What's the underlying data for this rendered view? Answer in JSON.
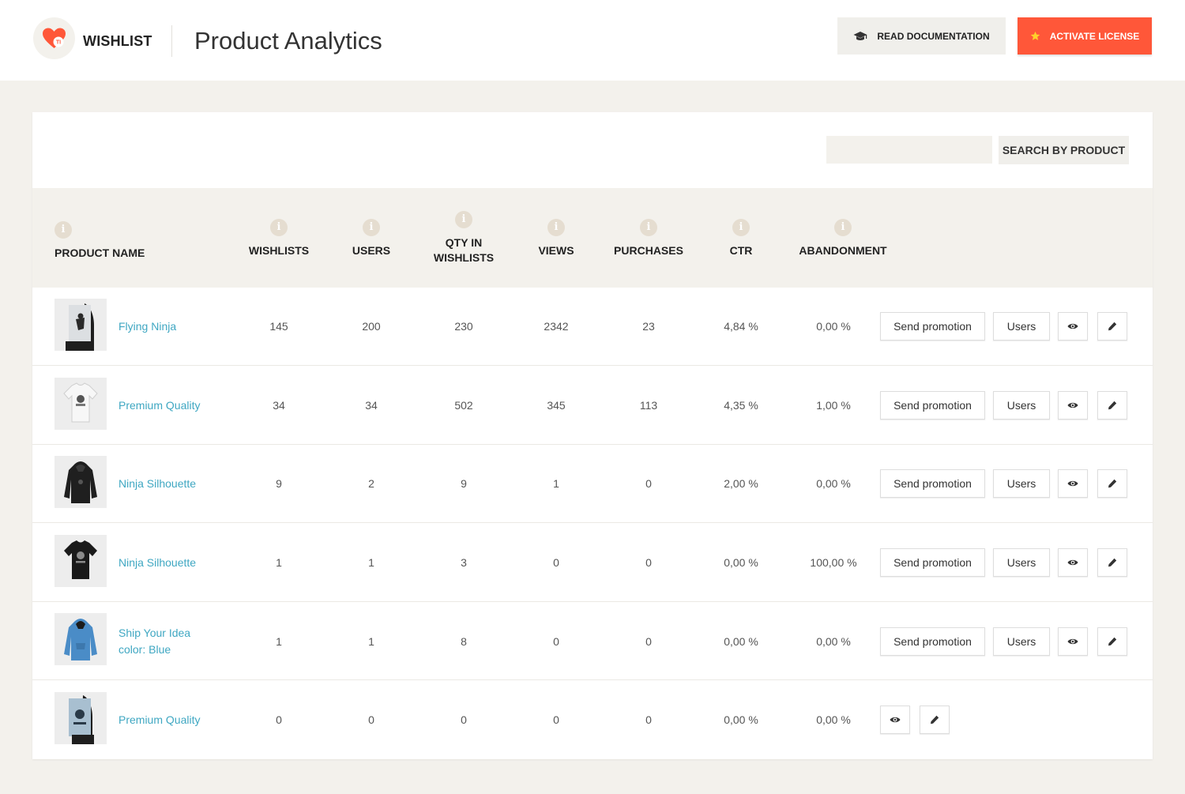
{
  "header": {
    "brand": "WISHLIST",
    "logo_badge": "TI",
    "title": "Product Analytics",
    "doc_button": "READ DOCUMENTATION",
    "license_button": "ACTIVATE LICENSE",
    "colors": {
      "accent": "#ff5739",
      "link": "#3fa7c2",
      "background": "#f3f1ec"
    }
  },
  "search": {
    "value": "",
    "button": "SEARCH BY PRODUCT"
  },
  "table": {
    "info_glyph": "i",
    "columns": {
      "product": "PRODUCT NAME",
      "wishlists": "WISHLISTS",
      "users": "USERS",
      "qty_line1": "QTY IN",
      "qty_line2": "WISHLISTS",
      "views": "VIEWS",
      "purchases": "PURCHASES",
      "ctr": "CTR",
      "abandonment": "ABANDONMENT"
    },
    "action_labels": {
      "promotion": "Send promotion",
      "users": "Users"
    },
    "rows": [
      {
        "name": "Flying Ninja",
        "thumb": "poster-icon",
        "wishlists": "145",
        "users": "200",
        "qty": "230",
        "views": "2342",
        "purchases": "23",
        "ctr": "4,84 %",
        "abandonment": "0,00 %"
      },
      {
        "name": "Premium Quality",
        "thumb": "white-tshirt-icon",
        "wishlists": "34",
        "users": "34",
        "qty": "502",
        "views": "345",
        "purchases": "113",
        "ctr": "4,35 %",
        "abandonment": "1,00 %"
      },
      {
        "name": "Ninja Silhouette",
        "thumb": "black-hoodie-icon",
        "wishlists": "9",
        "users": "2",
        "qty": "9",
        "views": "1",
        "purchases": "0",
        "ctr": "2,00 %",
        "abandonment": "0,00 %"
      },
      {
        "name": "Ninja Silhouette",
        "thumb": "black-tshirt-icon",
        "wishlists": "1",
        "users": "1",
        "qty": "3",
        "views": "0",
        "purchases": "0",
        "ctr": "0,00 %",
        "abandonment": "100,00 %"
      },
      {
        "name_line1": "Ship Your Idea",
        "name_line2": "color: Blue",
        "thumb": "blue-hoodie-icon",
        "wishlists": "1",
        "users": "1",
        "qty": "8",
        "views": "0",
        "purchases": "0",
        "ctr": "0,00 %",
        "abandonment": "0,00 %"
      },
      {
        "name": "Premium Quality",
        "thumb": "poster-icon",
        "wishlists": "0",
        "users": "0",
        "qty": "0",
        "views": "0",
        "purchases": "0",
        "ctr": "0,00 %",
        "abandonment": "0,00 %"
      }
    ]
  }
}
